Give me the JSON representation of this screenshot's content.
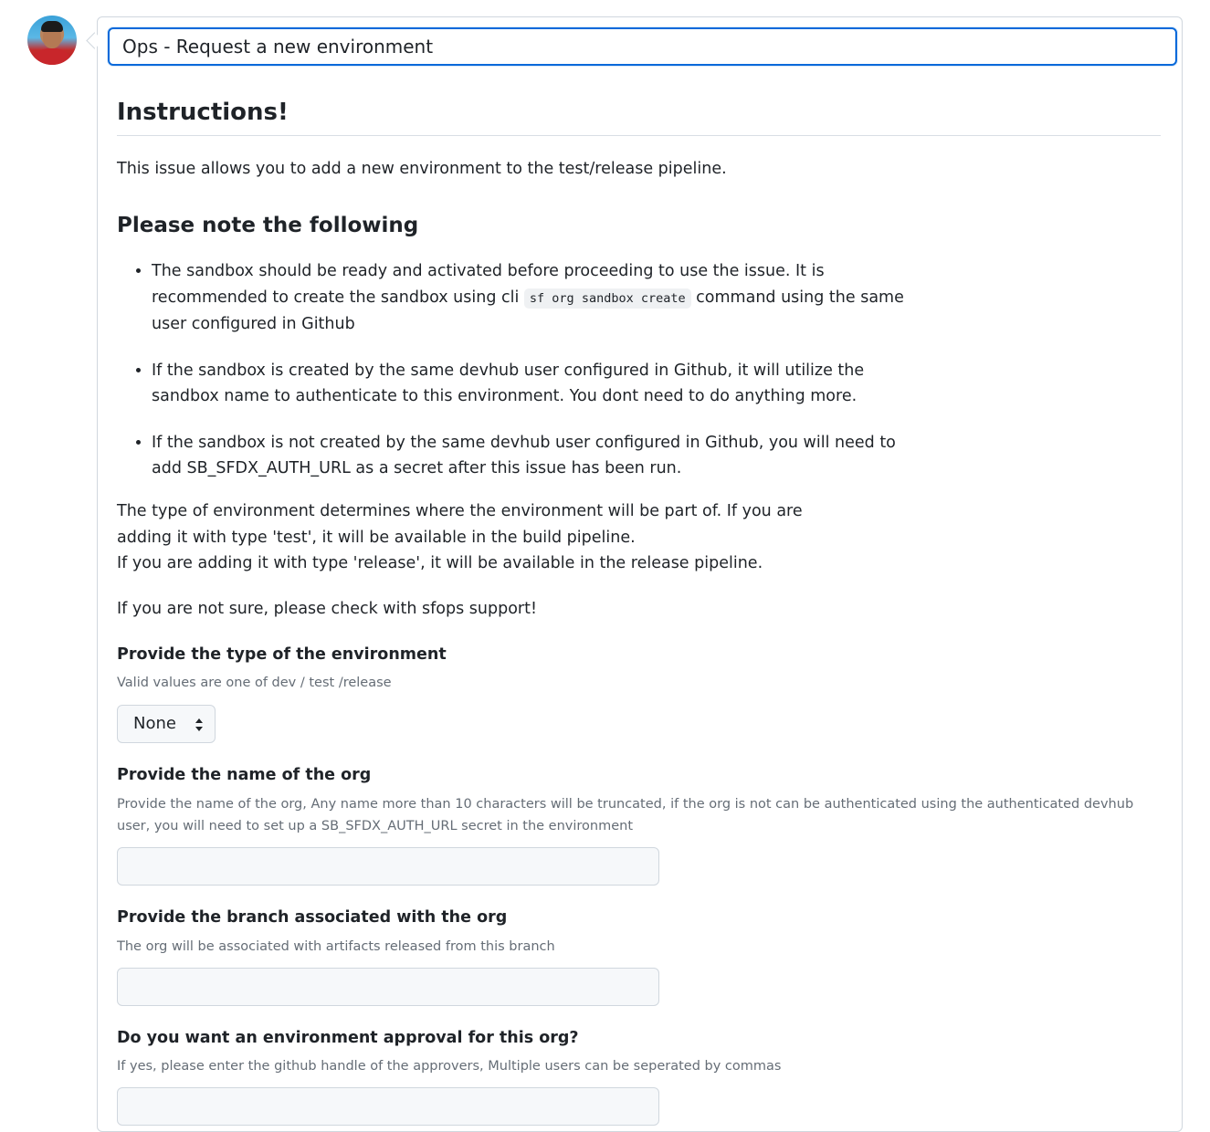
{
  "issue": {
    "title_value": "Ops - Request a new environment"
  },
  "body": {
    "heading": "Instructions!",
    "intro": "This issue allows you to add a new environment to the test/release pipeline.",
    "subheading": "Please note the following",
    "notes": [
      {
        "before": "The sandbox should be ready and activated before proceeding to use the issue. It is recommended to create the sandbox using cli ",
        "code": "sf org sandbox create",
        "after": " command using the same user configured in Github"
      },
      {
        "text": "If the sandbox is created by the same devhub user configured in Github, it will utilize the sandbox name to authenticate to this environment. You dont need to do anything more."
      },
      {
        "text": "If the sandbox is not created by the same devhub user configured in Github, you will need to add SB_SFDX_AUTH_URL as a secret after this issue has been run."
      }
    ],
    "type_paragraph_line1": "The type of environment determines where the environment will be part of. If you are adding it with type 'test', it will be available in the build pipeline.",
    "type_paragraph_line2": "If you are adding it with type 'release', it will be available in the release pipeline.",
    "support_text": "If you are not sure, please check with sfops support!"
  },
  "form": {
    "env_type": {
      "label": "Provide the type of the environment",
      "help": "Valid values are one of dev / test /release",
      "selected": "None"
    },
    "org_name": {
      "label": "Provide the name of the org",
      "help": "Provide the name of the org, Any name more than 10 characters will be truncated, if the org is not can be authenticated using the authenticated devhub user, you will need to set up a SB_SFDX_AUTH_URL secret in the environment",
      "value": ""
    },
    "branch": {
      "label": "Provide the branch associated with the org",
      "help": "The org will be associated with artifacts released from this branch",
      "value": ""
    },
    "approval": {
      "label": "Do you want an environment approval for this org?",
      "help": "If yes, please enter the github handle of the approvers, Multiple users can be seperated by commas",
      "value": ""
    }
  },
  "colors": {
    "accent": "#0969da",
    "muted_text": "#656d76",
    "border": "#d0d7de",
    "input_bg": "#f6f8fa"
  },
  "icons": {
    "avatar": "user-avatar",
    "select_arrows": "sort-arrows-icon"
  }
}
